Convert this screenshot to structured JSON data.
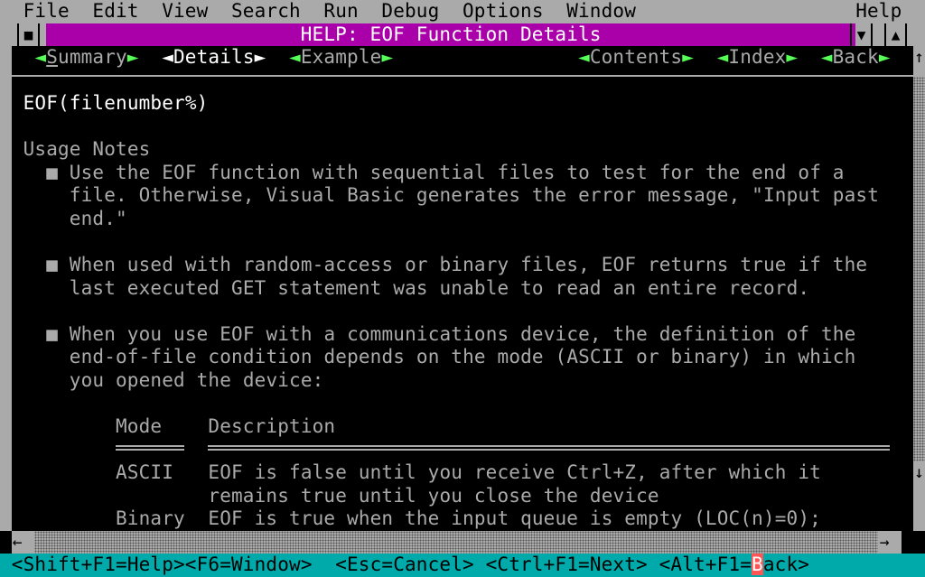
{
  "menu": {
    "items": [
      "File",
      "Edit",
      "View",
      "Search",
      "Run",
      "Debug",
      "Options",
      "Window"
    ],
    "help": "Help"
  },
  "window": {
    "title": "HELP: EOF Function Details",
    "system_box": "■",
    "minimize": "▼",
    "maximize": "▲"
  },
  "nav": {
    "links": [
      {
        "label": "Summary",
        "hotkey": "S",
        "rest": "ummary"
      },
      {
        "label": "Details"
      },
      {
        "label": "Example"
      },
      {
        "label": "Contents"
      },
      {
        "label": "Index"
      },
      {
        "label": "Back"
      }
    ],
    "current": "Details"
  },
  "doc": {
    "syntax": "EOF(filenumber%)",
    "section": "Usage Notes",
    "bullet": "■",
    "bullets": [
      [
        "Use the EOF function with sequential files to test for the end of a",
        "file. Otherwise, Visual Basic generates the error message, \"Input past",
        "end.\""
      ],
      [
        "When used with random-access or binary files, EOF returns true if the",
        "last executed GET statement was unable to read an entire record."
      ],
      [
        "When you use EOF with a communications device, the definition of the",
        "end-of-file condition depends on the mode (ASCII or binary) in which",
        "you opened the device:"
      ]
    ],
    "table": {
      "headers": [
        "Mode",
        "Description"
      ],
      "rows": [
        {
          "mode": "ASCII",
          "lines": [
            "EOF is false until you receive Ctrl+Z, after which it",
            "remains true until you close the device"
          ]
        },
        {
          "mode": "Binary",
          "lines": [
            "EOF is true when the input queue is empty (LOC(n)=0);"
          ]
        }
      ]
    }
  },
  "scroll": {
    "up": "↑",
    "down": "↓",
    "left": "←",
    "right": "→"
  },
  "status": {
    "items": [
      "<Shift+F1=Help>",
      "<F6=Window>",
      "<Esc=Cancel>",
      "<Ctrl+F1=Next>"
    ],
    "last_prefix": "<Alt+F1=",
    "last_hotkey": "B",
    "last_suffix": "ack>"
  },
  "colors": {
    "menu": "#aaaaaa",
    "title": "#aa00aa",
    "nav_arrow": "#55ff55",
    "status": "#00aaaa",
    "hotkey": "#ff5555"
  }
}
